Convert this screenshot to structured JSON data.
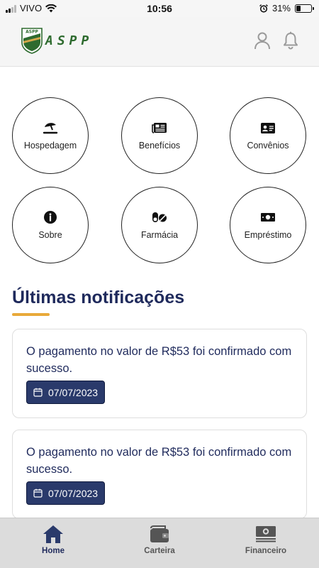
{
  "status_bar": {
    "carrier": "VIVO",
    "time": "10:56",
    "battery": "31%",
    "battery_level": 0.31,
    "icons": [
      "signal-icon",
      "wifi-icon",
      "alarm-icon",
      "battery-icon"
    ]
  },
  "header": {
    "logo_text": "ASPP",
    "icons": [
      "user-icon",
      "bell-icon"
    ]
  },
  "menu": {
    "items": [
      {
        "label": "Hospedagem",
        "icon": "beach-umbrella-icon"
      },
      {
        "label": "Benefícios",
        "icon": "newspaper-icon"
      },
      {
        "label": "Convênios",
        "icon": "id-card-icon"
      },
      {
        "label": "Sobre",
        "icon": "info-icon"
      },
      {
        "label": "Farmácia",
        "icon": "pills-icon"
      },
      {
        "label": "Empréstimo",
        "icon": "money-bill-icon"
      }
    ]
  },
  "notifications": {
    "title": "Últimas notificações",
    "accent_color": "#e8a93a",
    "items": [
      {
        "message": "O pagamento no valor de R$53 foi confirmado com sucesso.",
        "date": "07/07/2023"
      },
      {
        "message": "O pagamento no valor de R$53 foi confirmado com sucesso.",
        "date": "07/07/2023"
      }
    ]
  },
  "bottom_nav": {
    "items": [
      {
        "label": "Home",
        "icon": "home-icon",
        "active": true
      },
      {
        "label": "Carteira",
        "icon": "wallet-icon",
        "active": false
      },
      {
        "label": "Financeiro",
        "icon": "money-stack-icon",
        "active": false
      }
    ]
  },
  "colors": {
    "primary": "#1f2a5c",
    "badge": "#2a3a6b",
    "accent": "#e8a93a",
    "logo_green": "#2e6b2f"
  }
}
